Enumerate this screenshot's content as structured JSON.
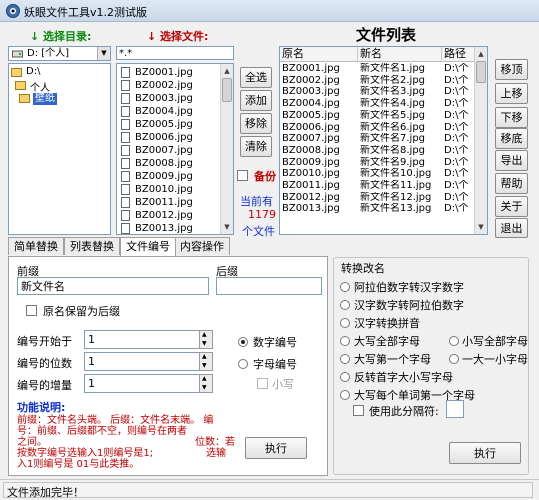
{
  "window": {
    "title": "妖眼文件工具v1.2测试版"
  },
  "labels": {
    "select_dir": "↓ 选择目录:",
    "select_file": "↓ 选择文件:",
    "file_list_title": "文件列表"
  },
  "drive": {
    "selected": "D: [个人]"
  },
  "dir_tree": [
    "D:\\",
    "个人",
    "壁纸"
  ],
  "file_filter": "*.*",
  "files": [
    "BZ0001.jpg",
    "BZ0002.jpg",
    "BZ0003.jpg",
    "BZ0004.jpg",
    "BZ0005.jpg",
    "BZ0006.jpg",
    "BZ0007.jpg",
    "BZ0008.jpg",
    "BZ0009.jpg",
    "BZ0010.jpg",
    "BZ0011.jpg",
    "BZ0012.jpg",
    "BZ0013.jpg"
  ],
  "mid_buttons": {
    "select_all": "全选",
    "add": "添加",
    "remove": "移除",
    "clear": "清除"
  },
  "backup_label": "备份",
  "count_info": {
    "prefix": "当前有",
    "count": "1179",
    "suffix": "个文件"
  },
  "table": {
    "headers": [
      "原名",
      "新名",
      "路径"
    ],
    "rows": [
      [
        "BZ0001.jpg",
        "新文件名1.jpg",
        "D:\\个"
      ],
      [
        "BZ0002.jpg",
        "新文件名2.jpg",
        "D:\\个"
      ],
      [
        "BZ0003.jpg",
        "新文件名3.jpg",
        "D:\\个"
      ],
      [
        "BZ0004.jpg",
        "新文件名4.jpg",
        "D:\\个"
      ],
      [
        "BZ0005.jpg",
        "新文件名5.jpg",
        "D:\\个"
      ],
      [
        "BZ0006.jpg",
        "新文件名6.jpg",
        "D:\\个"
      ],
      [
        "BZ0007.jpg",
        "新文件名7.jpg",
        "D:\\个"
      ],
      [
        "BZ0008.jpg",
        "新文件名8.jpg",
        "D:\\个"
      ],
      [
        "BZ0009.jpg",
        "新文件名9.jpg",
        "D:\\个"
      ],
      [
        "BZ0010.jpg",
        "新文件名10.jpg",
        "D:\\个"
      ],
      [
        "BZ0011.jpg",
        "新文件名11.jpg",
        "D:\\个"
      ],
      [
        "BZ0012.jpg",
        "新文件名12.jpg",
        "D:\\个"
      ],
      [
        "BZ0013.jpg",
        "新文件名13.jpg",
        "D:\\个"
      ]
    ]
  },
  "right_buttons": {
    "move_top": "移顶",
    "move_up": "上移",
    "move_down": "下移",
    "move_bottom": "移底",
    "export": "导出",
    "help": "帮助",
    "about": "关于",
    "exit": "退出"
  },
  "tabs": [
    "简单替换",
    "列表替换",
    "文件编号",
    "内容操作"
  ],
  "numbering": {
    "prefix_label": "前缀",
    "prefix_value": "新文件名",
    "suffix_label": "后缀",
    "suffix_value": "",
    "keep_original_label": "原名保留为后缀",
    "start_label": "编号开始于",
    "start_value": "1",
    "digits_label": "编号的位数",
    "digits_value": "1",
    "increment_label": "编号的增量",
    "increment_value": "1",
    "mode_numeric": "数字编号",
    "mode_alpha": "字母编号",
    "lowercase": "小写",
    "help_title": "功能说明:",
    "help_line1": "前缀：文件名头端。 后缀：文件名末端。 编",
    "help_line2": "号：前缀、后缀都不空，则编号在两者",
    "help_line3": "之间。",
    "help_line3b": "位数：若",
    "help_line4": "按数字编号选输入1则编号是1;",
    "help_line4b": "选输",
    "help_line5": "入1则编号是 01与此类推。",
    "execute": "执行"
  },
  "convert": {
    "title": "转换改名",
    "options": [
      "阿拉伯数字转汉字数字",
      "汉字数字转阿拉伯数字",
      "汉字转换拼音",
      "大写全部字母",
      "小写全部字母",
      "大写第一个字母",
      "一大一小字母",
      "反转首字大小写字母",
      "大写每个单词第一个字母"
    ],
    "use_separator": "使用此分隔符:",
    "separator_value": "",
    "execute": "执行"
  },
  "status": "文件添加完毕！"
}
